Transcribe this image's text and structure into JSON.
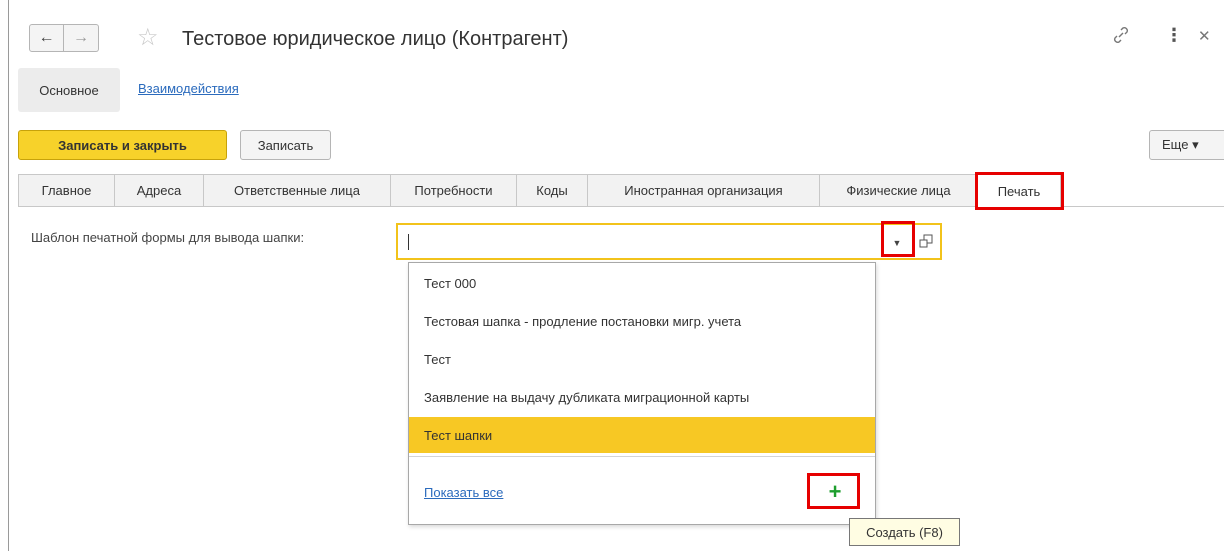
{
  "window": {
    "title": "Тестовое юридическое лицо (Контрагент)"
  },
  "nav": {
    "back_icon": "arrow-left-icon",
    "forward_icon": "arrow-right-icon",
    "favorite_icon": "star-icon",
    "link_icon": "link-icon",
    "more_icon": "more-vertical-icon",
    "close_icon": "close-icon"
  },
  "subnav": {
    "items": [
      {
        "label": "Основное",
        "active": true
      },
      {
        "label": "Взаимодействия",
        "active": false
      }
    ]
  },
  "toolbar": {
    "save_close_label": "Записать и закрыть",
    "save_label": "Записать",
    "more_label": "Еще ▾"
  },
  "tabs": [
    {
      "label": "Главное",
      "active": false
    },
    {
      "label": "Адреса",
      "active": false
    },
    {
      "label": "Ответственные лица",
      "active": false
    },
    {
      "label": "Потребности",
      "active": false
    },
    {
      "label": "Коды",
      "active": false
    },
    {
      "label": "Иностранная организация",
      "active": false
    },
    {
      "label": "Физические лица",
      "active": false
    },
    {
      "label": "Печать",
      "active": true
    }
  ],
  "field": {
    "label": "Шаблон печатной формы для вывода шапки:",
    "value": ""
  },
  "dropdown": {
    "items": [
      {
        "label": "Тест 000",
        "selected": false
      },
      {
        "label": "Тестовая шапка - продление постановки мигр. учета",
        "selected": false
      },
      {
        "label": "Тест",
        "selected": false
      },
      {
        "label": "Заявление на выдачу дубликата миграционной карты",
        "selected": false
      },
      {
        "label": "Тест шапки",
        "selected": true
      }
    ],
    "show_all_label": "Показать все",
    "add_symbol": "+"
  },
  "tooltip": {
    "text": "Создать (F8)"
  },
  "colors": {
    "primary_button": "#f7d22a",
    "selected_item": "#f7c824",
    "highlight": "#e60000",
    "link": "#2b6bbd",
    "add_icon": "#1e9e2e"
  }
}
